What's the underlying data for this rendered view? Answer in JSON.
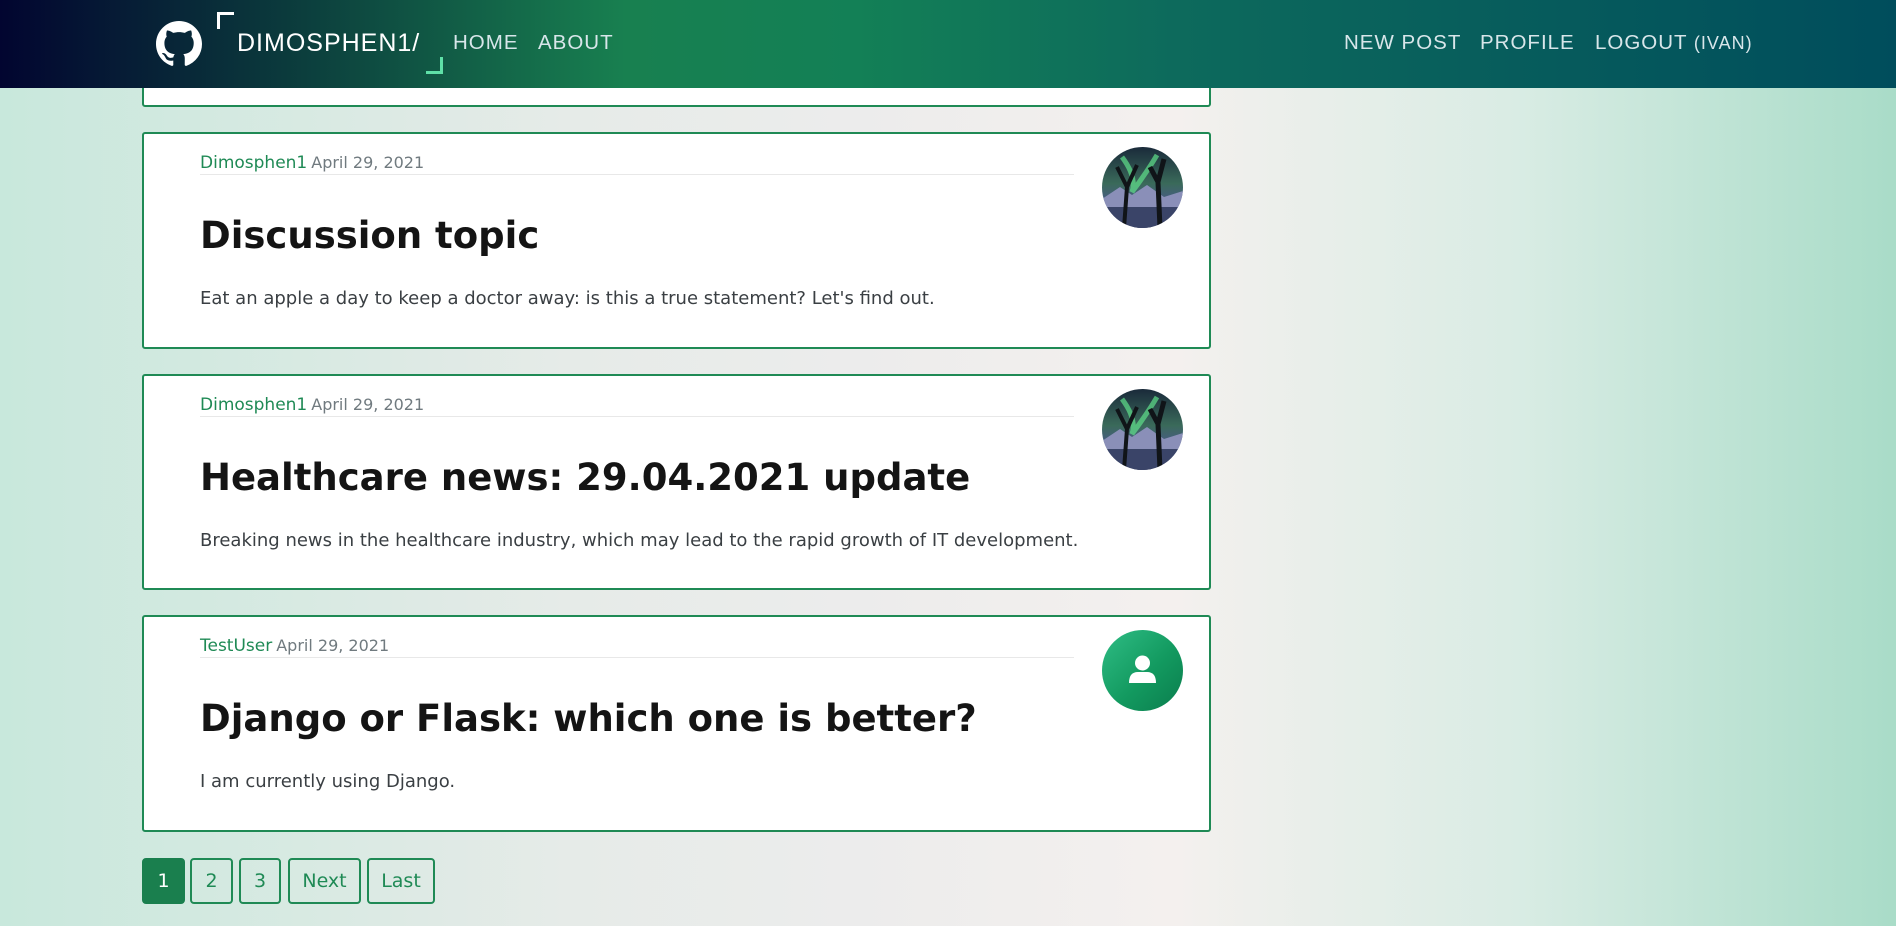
{
  "nav": {
    "brand": "DIMOSPHEN1/",
    "links": {
      "home": "HOME",
      "about": "ABOUT",
      "new_post": "NEW POST",
      "profile": "PROFILE",
      "logout": "LOGOUT",
      "logout_user": "(IVAN)"
    },
    "logo_icon": "github-icon"
  },
  "posts": [
    {
      "author": "Dimosphen1",
      "date": "April 29, 2021",
      "title": "Discussion topic",
      "content": "Eat an apple a day to keep a doctor away: is this a true statement? Let's find out.",
      "avatar": "aurora-landscape-avatar"
    },
    {
      "author": "Dimosphen1",
      "date": "April 29, 2021",
      "title": "Healthcare news: 29.04.2021 update",
      "content": "Breaking news in the healthcare industry, which may lead to the rapid growth of IT development.",
      "avatar": "aurora-landscape-avatar"
    },
    {
      "author": "TestUser",
      "date": "April 29, 2021",
      "title": "Django or Flask: which one is better?",
      "content": "I am currently using Django.",
      "avatar": "default-user-avatar"
    }
  ],
  "pagination": {
    "pages": [
      "1",
      "2",
      "3"
    ],
    "current": "1",
    "next": "Next",
    "last": "Last"
  },
  "colors": {
    "accent": "#1f8a55",
    "nav_start": "#020530",
    "nav_mid": "#188050",
    "nav_end": "#004d5c"
  }
}
